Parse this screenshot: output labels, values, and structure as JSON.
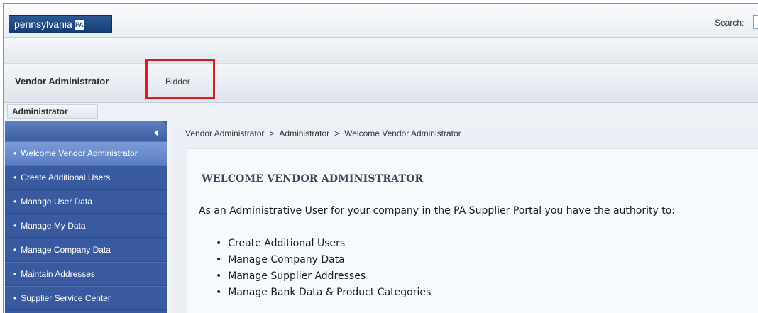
{
  "header": {
    "logo_text": "pennsylvania",
    "logo_badge": "PA",
    "search_label": "Search:",
    "search_value": ""
  },
  "tabs": {
    "vendor_administrator": "Vendor Administrator",
    "bidder": "Bidder"
  },
  "subtab": "Administrator",
  "sidebar": {
    "items": [
      {
        "label": "Welcome Vendor Administrator"
      },
      {
        "label": "Create Additional Users"
      },
      {
        "label": "Manage User Data"
      },
      {
        "label": "Manage My Data"
      },
      {
        "label": "Manage Company Data"
      },
      {
        "label": "Maintain Addresses"
      },
      {
        "label": "Supplier Service Center"
      }
    ]
  },
  "breadcrumb": [
    "Vendor Administrator",
    "Administrator",
    "Welcome Vendor Administrator"
  ],
  "breadcrumb_separator": ">",
  "content": {
    "title": "WELCOME VENDOR ADMINISTRATOR",
    "intro": "As an Administrative User for your company in the PA Supplier Portal you have the authority to:",
    "tasks": [
      "Create Additional Users",
      "Manage Company Data",
      "Manage Supplier Addresses",
      "Manage Bank Data & Product Categories"
    ]
  },
  "colors": {
    "highlight_box": "#e01b1b",
    "sidebar_bg": "#3a5aa0",
    "logo_bg": "#1f4c8a"
  }
}
